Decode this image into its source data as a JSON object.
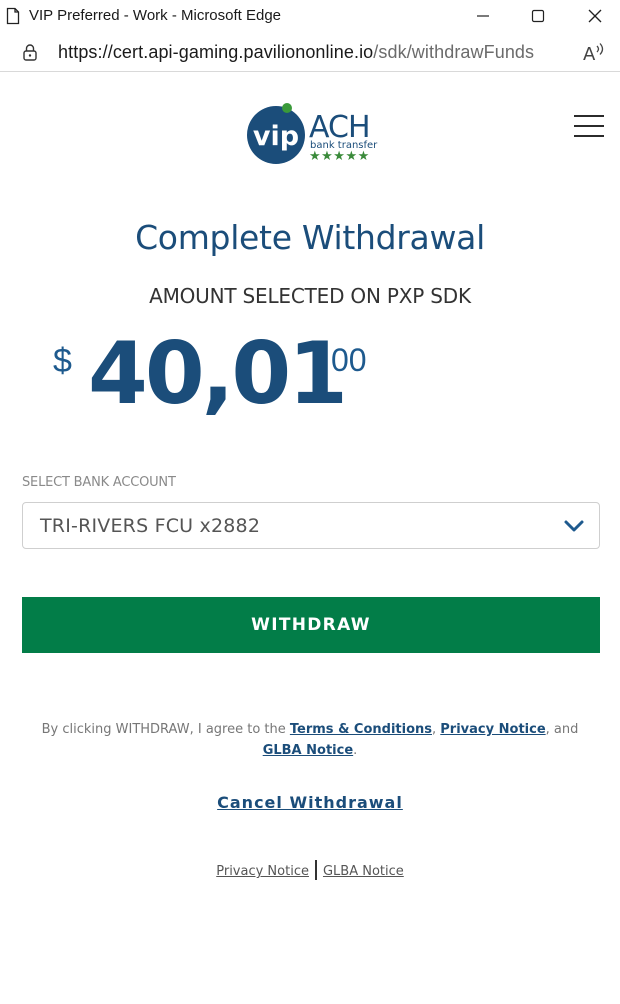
{
  "window": {
    "title": "VIP Preferred - Work - Microsoft Edge",
    "icons": [
      "page-icon",
      "minimize-icon",
      "maximize-icon",
      "close-icon"
    ]
  },
  "address_bar": {
    "url_host": "https://cert.api-gaming.paviliononline.io",
    "url_path": "/sdk/withdrawFunds",
    "icons": [
      "lock-icon",
      "read-aloud-icon"
    ]
  },
  "logo": {
    "vip": "vip",
    "ach": "ACH",
    "tagline": "bank transfer",
    "stars": "★★★★★"
  },
  "heading": "Complete Withdrawal",
  "subheading": "AMOUNT SELECTED ON PXP SDK",
  "amount": {
    "currency": "$",
    "whole": "40,01",
    "cents": "00"
  },
  "bank_select": {
    "label": "SELECT BANK ACCOUNT",
    "value": "TRI-RIVERS FCU x2882"
  },
  "withdraw_button": "WITHDRAW",
  "agreement": {
    "prefix": "By clicking WITHDRAW, I agree to the ",
    "terms": "Terms & Conditions",
    "comma": ", ",
    "privacy": "Privacy Notice",
    "and": ", and",
    "glba": "GLBA Notice",
    "period": "."
  },
  "cancel_link": "Cancel Withdrawal",
  "footer": {
    "privacy": "Privacy Notice",
    "glba": "GLBA Notice"
  },
  "colors": {
    "primary_blue": "#1b4d7a",
    "withdraw_green": "#027d48",
    "star_green": "#3a8a3a"
  }
}
